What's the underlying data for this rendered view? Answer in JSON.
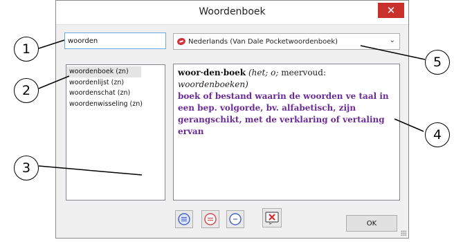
{
  "window": {
    "title": "Woordenboek",
    "close_label": "✕"
  },
  "search": {
    "value": "woorden"
  },
  "dictionary_select": {
    "selected": "Nederlands (Van Dale Pocketwoordenboek)"
  },
  "results": {
    "items": [
      {
        "label": "woordenboek (zn)",
        "selected": true
      },
      {
        "label": "woordenlijst (zn)",
        "selected": false
      },
      {
        "label": "woordenschat (zn)",
        "selected": false
      },
      {
        "label": "woordenwisseling (zn)",
        "selected": false
      }
    ]
  },
  "definition": {
    "headword": "woor·den·boek",
    "grammar": "(het; o;",
    "plural_label": "meervoud:",
    "plural_form": "woordenboeken)",
    "meaning": "boek of bestand waarin de woorden ve taal in een bep. volgorde, bv. alfabetisch, zijn gerangschikt, met de verklaring of vertaling ervan"
  },
  "buttons": {
    "ok_label": "OK"
  },
  "callouts": [
    "1",
    "2",
    "3",
    "4",
    "5"
  ],
  "colors": {
    "close_button": "#c9302c",
    "definition_text": "#6b2b94",
    "input_focus_border": "#6aa7e3",
    "button_blue": "#4a66c9",
    "button_red": "#d24b4b"
  }
}
